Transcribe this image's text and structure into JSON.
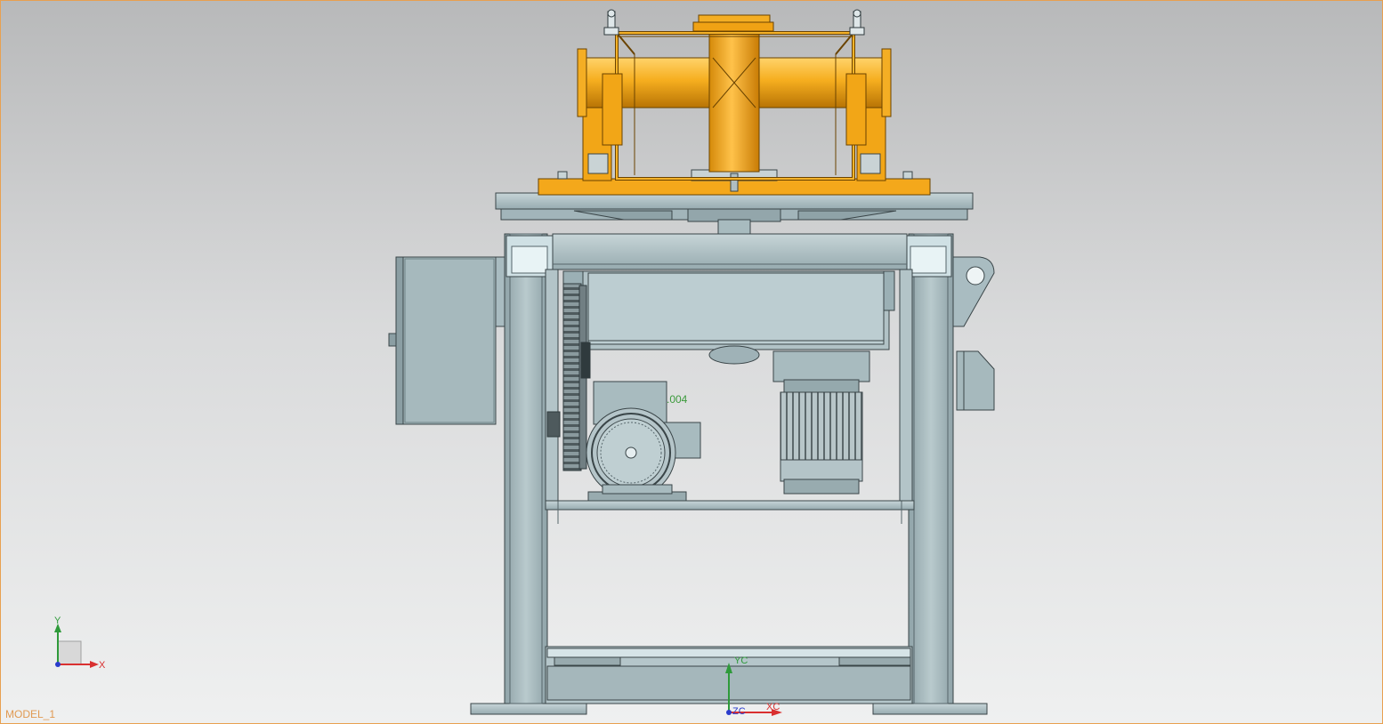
{
  "viewport": {
    "model_name": "MODEL_1",
    "dimension_label": ".004",
    "background_top": "#b8b9ba",
    "background_bottom": "#eff0f0",
    "frame_color": "#e8a050"
  },
  "triad": {
    "y_label": "Y",
    "x_label": "X"
  },
  "wcs": {
    "yc_label": "YC",
    "xc_label": "XC",
    "zc_label": "ZC"
  },
  "colors": {
    "steel": "#a9bcc1",
    "steel_dark": "#7f9297",
    "steel_light": "#c9d6d9",
    "outline": "#3a4548",
    "orange": "#f4a81b",
    "orange_dark": "#d98a0c",
    "axis_x": "#d93030",
    "axis_y": "#2e9a3a",
    "axis_z": "#2a3ccc"
  }
}
